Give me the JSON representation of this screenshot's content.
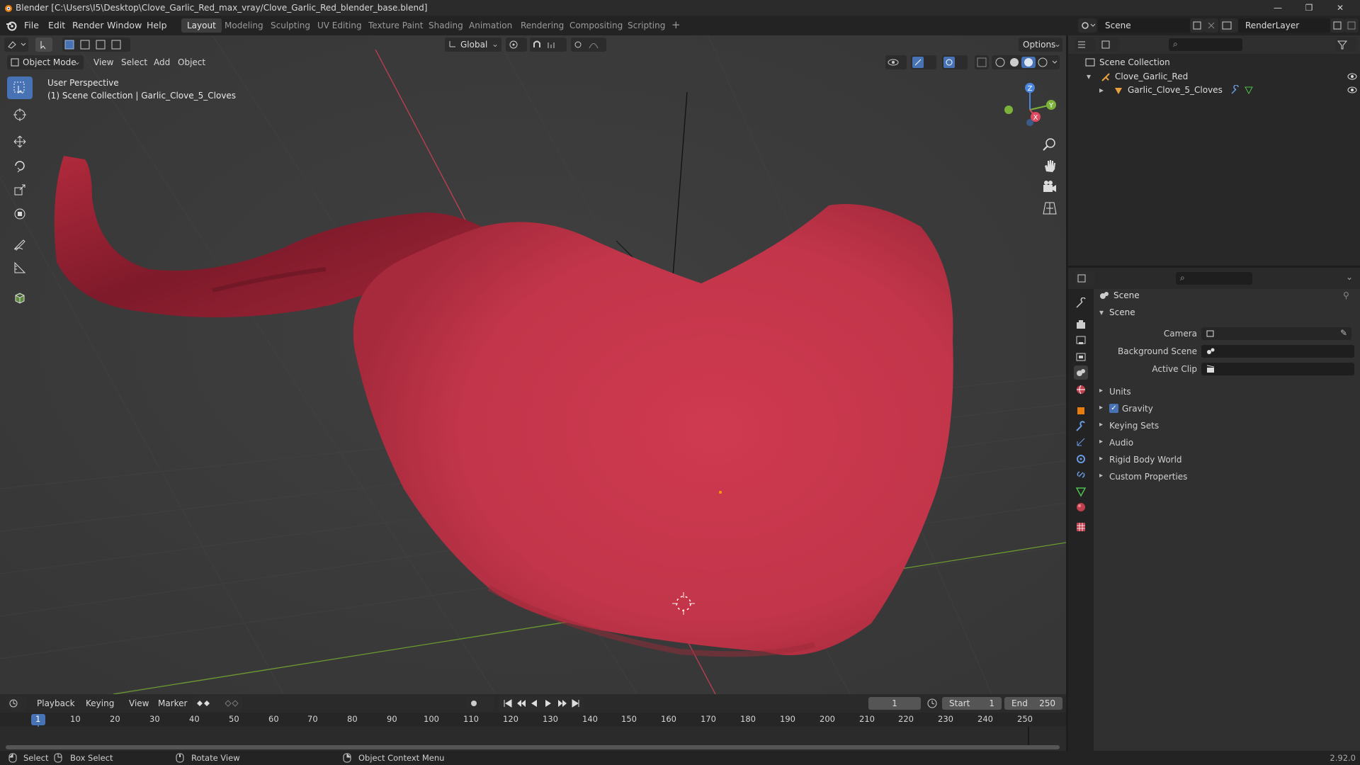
{
  "window": {
    "title": "Blender [C:\\Users\\I5\\Desktop\\Clove_Garlic_Red_max_vray/Clove_Garlic_Red_blender_base.blend]"
  },
  "menu": [
    "File",
    "Edit",
    "Render",
    "Window",
    "Help"
  ],
  "workspaces": [
    "Layout",
    "Modeling",
    "Sculpting",
    "UV Editing",
    "Texture Paint",
    "Shading",
    "Animation",
    "Rendering",
    "Compositing",
    "Scripting"
  ],
  "active_workspace": "Layout",
  "scene_selector": {
    "value": "Scene"
  },
  "renderlayer_selector": {
    "value": "RenderLayer"
  },
  "viewport_header": {
    "transform_orientation": "Global",
    "options_label": "Options",
    "mode": "Object Mode",
    "menus": [
      "View",
      "Select",
      "Add",
      "Object"
    ]
  },
  "viewport": {
    "perspective_label": "User Perspective",
    "collection_label": "(1) Scene Collection | Garlic_Clove_5_Cloves",
    "mesh_color": "#c83a4e",
    "grid_color": "#3a3a3a"
  },
  "gizmo": {
    "x": "X",
    "y": "Y",
    "z": "Z"
  },
  "outliner": {
    "root": "Scene Collection",
    "items": [
      {
        "label": "Clove_Garlic_Red",
        "icon": "armature-icon"
      },
      {
        "label": "Garlic_Clove_5_Cloves",
        "icon": "mesh-icon"
      }
    ]
  },
  "properties": {
    "header": "Scene",
    "panel_title": "Scene",
    "camera_label": "Camera",
    "background_scene_label": "Background Scene",
    "active_clip_label": "Active Clip",
    "sections": [
      "Units",
      "Gravity",
      "Keying Sets",
      "Audio",
      "Rigid Body World",
      "Custom Properties"
    ],
    "gravity_checked": true
  },
  "timeline": {
    "menus": [
      "Playback",
      "Keying",
      "View",
      "Marker"
    ],
    "current_frame": "1",
    "start_label": "Start",
    "start_value": "1",
    "end_label": "End",
    "end_value": "250",
    "ruler": [
      "1",
      "10",
      "20",
      "30",
      "40",
      "50",
      "60",
      "70",
      "80",
      "90",
      "100",
      "110",
      "120",
      "130",
      "140",
      "150",
      "160",
      "170",
      "180",
      "190",
      "200",
      "210",
      "220",
      "230",
      "240",
      "250"
    ]
  },
  "statusbar": {
    "items": [
      "Select",
      "Box Select",
      "Rotate View",
      "Object Context Menu"
    ],
    "version": "2.92.0"
  },
  "colors": {
    "accent": "#4772b3",
    "x_axis": "#e04a5f",
    "y_axis": "#7bb33a",
    "z_axis": "#4a86e0"
  }
}
